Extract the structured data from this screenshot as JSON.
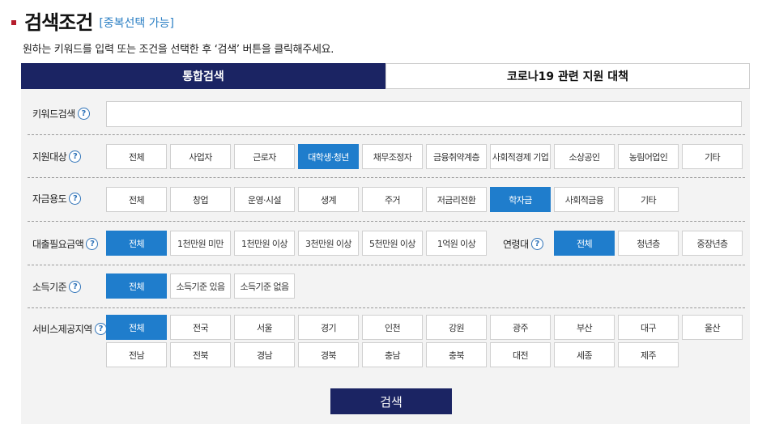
{
  "header": {
    "title": "검색조건",
    "subtitle": "[중복선택 가능]",
    "description": "원하는 키워드를 입력 또는 조건을 선택한 후 ‘검색’ 버튼을 클릭해주세요."
  },
  "tabs": [
    {
      "label": "통합검색",
      "active": true
    },
    {
      "label": "코로나19 관련 지원 대책",
      "active": false
    }
  ],
  "help_glyph": "?",
  "keyword": {
    "label": "키워드검색",
    "value": "",
    "placeholder": ""
  },
  "target": {
    "label": "지원대상",
    "options": [
      "전체",
      "사업자",
      "근로자",
      "대학생·청년",
      "채무조정자",
      "금융취약계층",
      "사회적경제 기업",
      "소상공인",
      "농림어업인",
      "기타"
    ],
    "selected": "대학생·청년"
  },
  "purpose": {
    "label": "자금용도",
    "options": [
      "전체",
      "창업",
      "운영·시설",
      "생계",
      "주거",
      "저금리전환",
      "학자금",
      "사회적금융",
      "기타"
    ],
    "selected": "학자금"
  },
  "amount": {
    "label": "대출필요금액",
    "options": [
      "전체",
      "1천만원 미만",
      "1천만원 이상",
      "3천만원 이상",
      "5천만원 이상",
      "1억원 이상"
    ],
    "selected": "전체"
  },
  "age": {
    "label": "연령대",
    "options": [
      "전체",
      "청년층",
      "중장년층"
    ],
    "selected": "전체"
  },
  "income": {
    "label": "소득기준",
    "options": [
      "전체",
      "소득기준 있음",
      "소득기준 없음"
    ],
    "selected": "전체"
  },
  "region": {
    "label": "서비스제공지역",
    "options": [
      "전체",
      "전국",
      "서울",
      "경기",
      "인천",
      "강원",
      "광주",
      "부산",
      "대구",
      "울산",
      "전남",
      "전북",
      "경남",
      "경북",
      "충남",
      "충북",
      "대전",
      "세종",
      "제주"
    ],
    "selected": "전체"
  },
  "search_button": "검색",
  "colors": {
    "navy": "#1b2463",
    "selected": "#1f7dcc",
    "title_mark": "#b51c2c",
    "help": "#2f73b8"
  }
}
